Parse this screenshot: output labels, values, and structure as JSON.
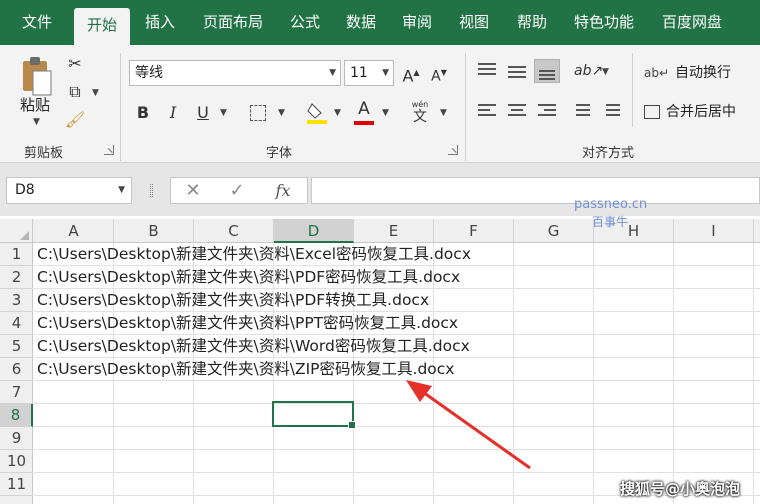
{
  "tabs": [
    "文件",
    "开始",
    "插入",
    "页面布局",
    "公式",
    "数据",
    "审阅",
    "视图",
    "帮助",
    "特色功能",
    "百度网盘"
  ],
  "active_tab": "开始",
  "clipboard": {
    "paste_label": "粘贴",
    "group_label": "剪贴板"
  },
  "font": {
    "name": "等线",
    "size": "11",
    "group_label": "字体",
    "phonetic_label": "wén",
    "phonetic_char": "文"
  },
  "alignment": {
    "wrap_text": "自动换行",
    "merge_center": "合并后居中",
    "group_label": "对齐方式"
  },
  "formula_bar": {
    "name_box": "D8",
    "fx": "fx",
    "cancel": "✕",
    "enter": "✓"
  },
  "columns": [
    "A",
    "B",
    "C",
    "D",
    "E",
    "F",
    "G",
    "H",
    "I"
  ],
  "selected_column": "D",
  "rows": [
    "1",
    "2",
    "3",
    "4",
    "5",
    "6",
    "7",
    "8",
    "9",
    "10",
    "11"
  ],
  "selected_row": "8",
  "cells": [
    "C:\\Users\\Desktop\\新建文件夹\\资料\\Excel密码恢复工具.docx",
    "C:\\Users\\Desktop\\新建文件夹\\资料\\PDF密码恢复工具.docx",
    "C:\\Users\\Desktop\\新建文件夹\\资料\\PDF转换工具.docx",
    "C:\\Users\\Desktop\\新建文件夹\\资料\\PPT密码恢复工具.docx",
    "C:\\Users\\Desktop\\新建文件夹\\资料\\Word密码恢复工具.docx",
    "C:\\Users\\Desktop\\新建文件夹\\资料\\ZIP密码恢复工具.docx"
  ],
  "watermarks": {
    "site": "passneo.cn",
    "site_sub": "百事牛",
    "author": "搜狐号@小奥泡泡"
  },
  "colors": {
    "excel_green": "#217346",
    "arrow_red": "#e5302a"
  }
}
